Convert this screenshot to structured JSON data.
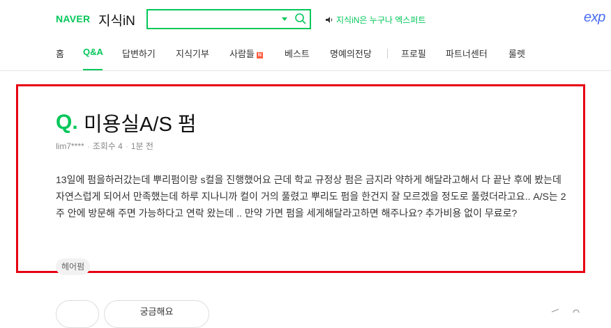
{
  "header": {
    "brand": "NAVER",
    "service": "지식iN",
    "search": {
      "value": "",
      "placeholder": ""
    },
    "notice": "지식iN은 누구나 엑스퍼트",
    "exp_logo": "exp"
  },
  "nav": {
    "items": [
      {
        "label": "홈"
      },
      {
        "label": "Q&A",
        "active": true
      },
      {
        "label": "답변하기"
      },
      {
        "label": "지식기부"
      },
      {
        "label": "사람들",
        "badge": "N"
      },
      {
        "label": "베스트"
      },
      {
        "label": "명예의전당"
      },
      {
        "label": "프로필"
      },
      {
        "label": "파트너센터"
      },
      {
        "label": "룰렛"
      }
    ]
  },
  "question": {
    "q_mark": "Q.",
    "title": "미용실A/S 펌",
    "author": "lim7****",
    "views": "조회수 4",
    "time": "1분 전",
    "body": "13일에 펌을하러갔는데 뿌리펌이랑 s컬을 진행했어요 근데 학교 규정상 펌은 금지라 약하게 해달라고해서 다 끝난 후에 봤는데 자연스럽게 되어서 만족했는데 하루 지나니까 컬이 거의 풀렸고 뿌리도 펌을 한건지 잘 모르겠을 정도로 풀렸더라고요.. A/S는 2주 안에 방문해 주면 가능하다고 연락 왔는데 .. 만약 가면 펌을 세게해달라고하면 해주나요? 추가비용 없이 무료로?",
    "tag": "헤어펌"
  },
  "actions": {
    "curious_label": "궁금해요"
  },
  "colors": {
    "brand_green": "#03c75a",
    "highlight_red": "#e60012",
    "exp_blue": "#4a6cf0"
  }
}
